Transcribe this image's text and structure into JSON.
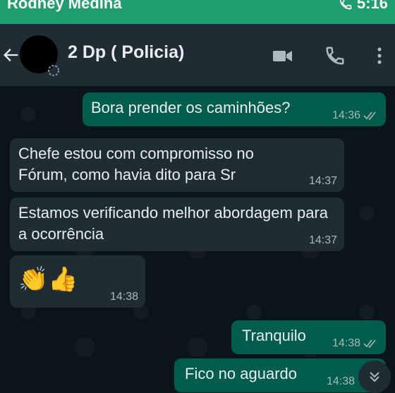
{
  "status_bar": {
    "name": "Rodney Medina",
    "time": "5:16",
    "call_icon": "phone-icon"
  },
  "header": {
    "title": "2 Dp ( Policia)",
    "icons": [
      "back-arrow-icon",
      "video-camera-icon",
      "phone-icon",
      "more-vertical-icon"
    ]
  },
  "messages": [
    {
      "direction": "out",
      "text": "Bora prender os caminhões?",
      "time": "14:36",
      "status": "read"
    },
    {
      "direction": "in",
      "text": "Chefe estou com compromisso no Fórum, como havia dito para Sr",
      "time": "14:37"
    },
    {
      "direction": "in",
      "text": "Estamos verificando melhor abordagem para a ocorrência",
      "time": "14:37"
    },
    {
      "direction": "in",
      "text": "👏👍",
      "time": "14:38"
    },
    {
      "direction": "out",
      "text": "Tranquilo",
      "time": "14:38",
      "status": "read"
    },
    {
      "direction": "out",
      "text": "Fico  no aguardo",
      "time": "14:38",
      "status": "read"
    }
  ],
  "colors": {
    "status_bar": "#1f9d6c",
    "header": "#202c33",
    "background": "#0b141a",
    "outgoing": "#005c4b",
    "incoming": "#202c33"
  }
}
